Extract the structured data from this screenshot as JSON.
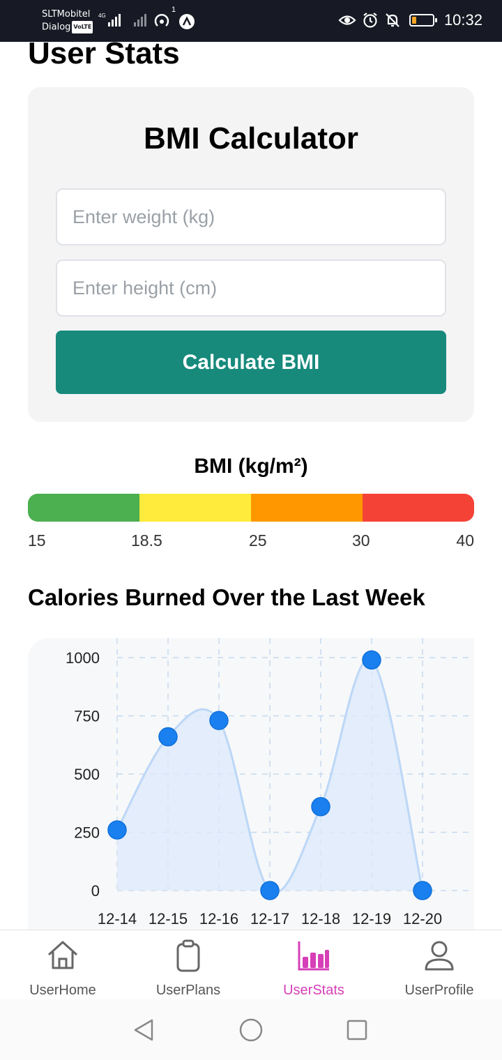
{
  "status_bar": {
    "carrier_1": "SLTMobitel",
    "carrier_2": "Dialog",
    "volte": "VoLTE",
    "network": "4G",
    "notification_count": "1",
    "time": "10:32",
    "icons": [
      "eye-icon",
      "alarm-icon",
      "bell-off-icon",
      "battery-icon"
    ]
  },
  "page": {
    "title": "User Stats"
  },
  "bmi_card": {
    "title": "BMI Calculator",
    "weight_placeholder": "Enter weight (kg)",
    "height_placeholder": "Enter height (cm)",
    "calculate_label": "Calculate BMI",
    "accent_color": "#178a7c"
  },
  "bmi_scale": {
    "title": "BMI (kg/m²)",
    "segments": [
      {
        "color": "#4caf50"
      },
      {
        "color": "#ffeb3b"
      },
      {
        "color": "#ff9800"
      },
      {
        "color": "#f44336"
      }
    ],
    "ticks": [
      "15",
      "18.5",
      "25",
      "30",
      "40"
    ]
  },
  "chart_section": {
    "title": "Calories Burned Over the Last Week"
  },
  "chart_data": {
    "type": "area",
    "title": "Calories Burned Over the Last Week",
    "categories": [
      "12-14",
      "12-15",
      "12-16",
      "12-17",
      "12-18",
      "12-19",
      "12-20"
    ],
    "series": [
      {
        "values": [
          260,
          660,
          730,
          0,
          360,
          990,
          0
        ]
      }
    ],
    "y_ticks": [
      "0",
      "250",
      "500",
      "750",
      "1000"
    ],
    "ylim": [
      0,
      1000
    ],
    "grid": true,
    "colors": {
      "line": "#bcd7f7",
      "fill": "#dceafb",
      "point": "#1a80f0"
    }
  },
  "bottom_nav": {
    "items": [
      {
        "label": "UserHome",
        "icon": "home-icon",
        "active": false
      },
      {
        "label": "UserPlans",
        "icon": "clipboard-icon",
        "active": false
      },
      {
        "label": "UserStats",
        "icon": "bar-chart-icon",
        "active": true
      },
      {
        "label": "UserProfile",
        "icon": "user-icon",
        "active": false
      }
    ],
    "active_color": "#d63fb8"
  },
  "system_nav": {
    "icons": [
      "back-icon",
      "home-circle-icon",
      "recents-icon"
    ]
  }
}
